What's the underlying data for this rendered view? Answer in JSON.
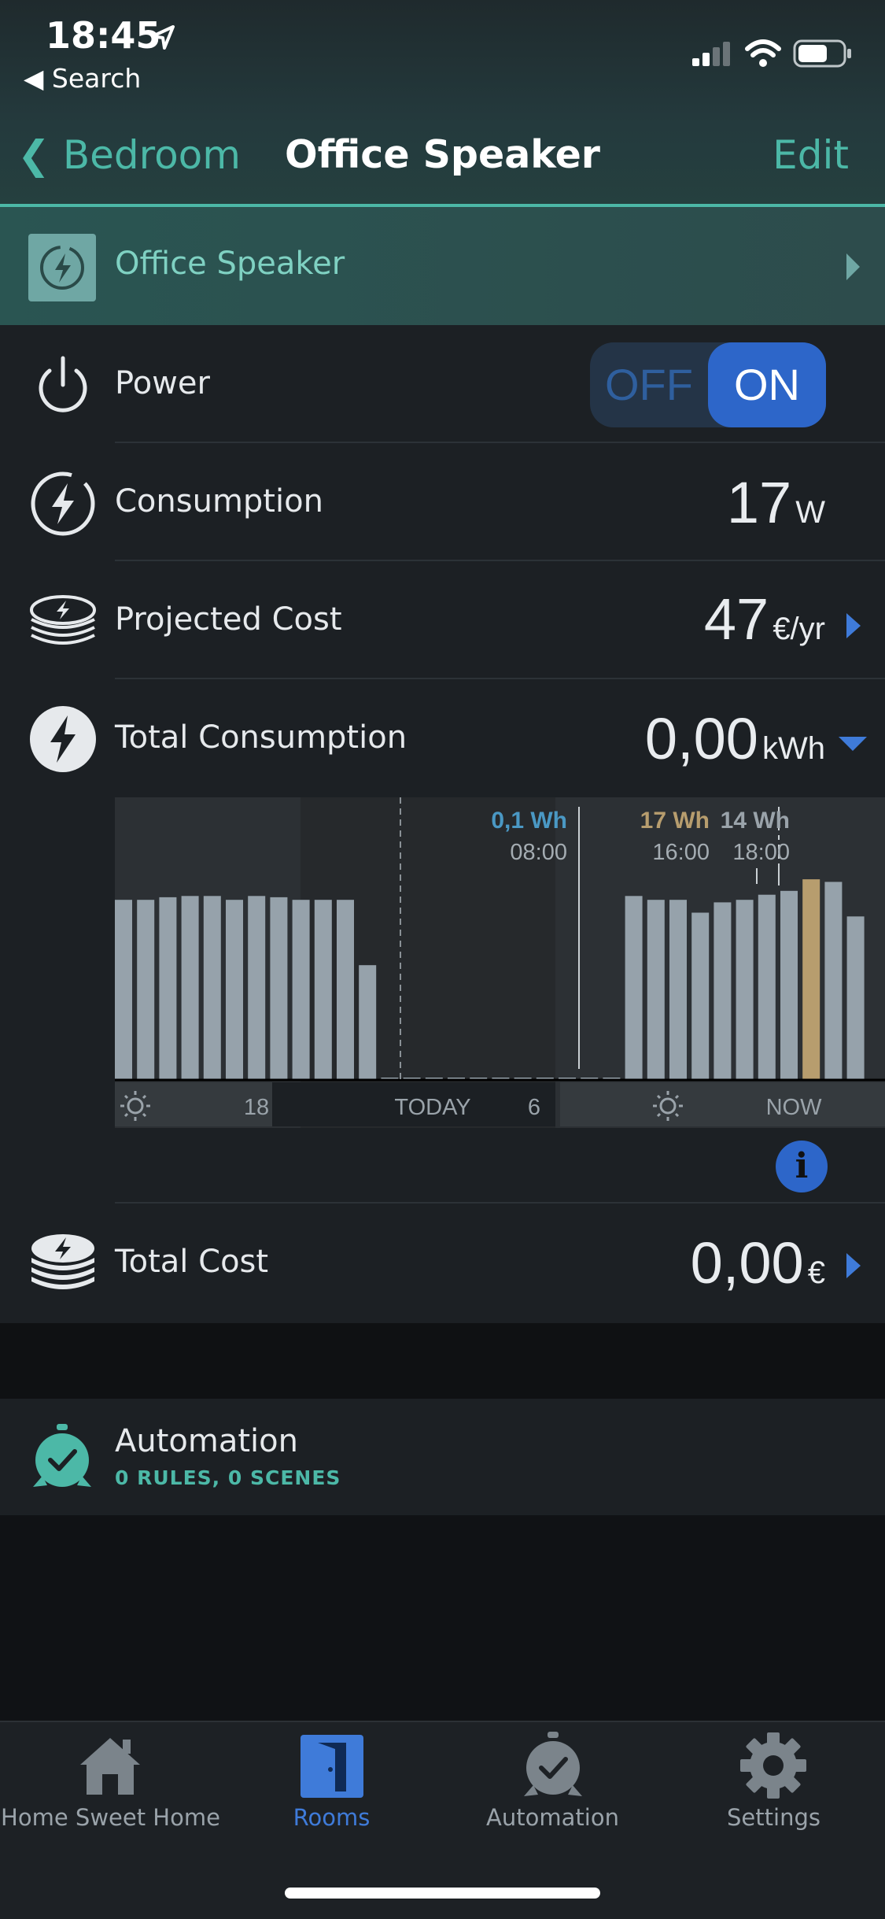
{
  "status_bar": {
    "time": "18:45",
    "back_app": "Search"
  },
  "nav": {
    "back_label": "Bedroom",
    "title": "Office Speaker",
    "edit_label": "Edit"
  },
  "device": {
    "name": "Office Speaker"
  },
  "power": {
    "label": "Power",
    "off_label": "OFF",
    "on_label": "ON",
    "state": "ON"
  },
  "consumption": {
    "label": "Consumption",
    "value": "17",
    "unit": "W"
  },
  "projected_cost": {
    "label": "Projected Cost",
    "value": "47",
    "unit": "€/yr"
  },
  "total_consumption": {
    "label": "Total Consumption",
    "value": "0,00",
    "unit": "kWh"
  },
  "chart_data": {
    "type": "bar",
    "annotations": [
      {
        "value": "0,1 Wh",
        "time": "08:00",
        "color": "#4a98c4"
      },
      {
        "value": "17 Wh",
        "time": "16:00",
        "color": "#b79d6e"
      },
      {
        "value": "14 Wh",
        "time": "18:00",
        "color": "#9aa3aa"
      }
    ],
    "x_tick_labels": [
      "18",
      "TODAY",
      "6",
      "NOW"
    ],
    "values": [
      14,
      14,
      14.2,
      14.3,
      14.3,
      14,
      14.3,
      14.2,
      14,
      14,
      14,
      8.9,
      0.1,
      0.1,
      0.1,
      0.1,
      0.1,
      0.1,
      0.1,
      0.1,
      0.1,
      0.1,
      0.1,
      14.3,
      14,
      14,
      13,
      13.8,
      14,
      14.4,
      14.7,
      15.6,
      15.4,
      12.7
    ],
    "highlight_index": 31,
    "bar_color": "#96a2ab",
    "highlight_color": "#b79d6e"
  },
  "total_cost": {
    "label": "Total Cost",
    "value": "0,00",
    "unit": "€"
  },
  "automation": {
    "label": "Automation",
    "subtitle": "0 RULES, 0 SCENES"
  },
  "tabs": [
    {
      "label": "Home Sweet Home",
      "icon": "house-icon",
      "active": false
    },
    {
      "label": "Rooms",
      "icon": "door-icon",
      "active": true
    },
    {
      "label": "Automation",
      "icon": "alarm-clock-icon",
      "active": false
    },
    {
      "label": "Settings",
      "icon": "gear-icon",
      "active": false
    }
  ],
  "colors": {
    "accent_teal": "#4cb8a7",
    "accent_blue": "#3f7bd9"
  }
}
